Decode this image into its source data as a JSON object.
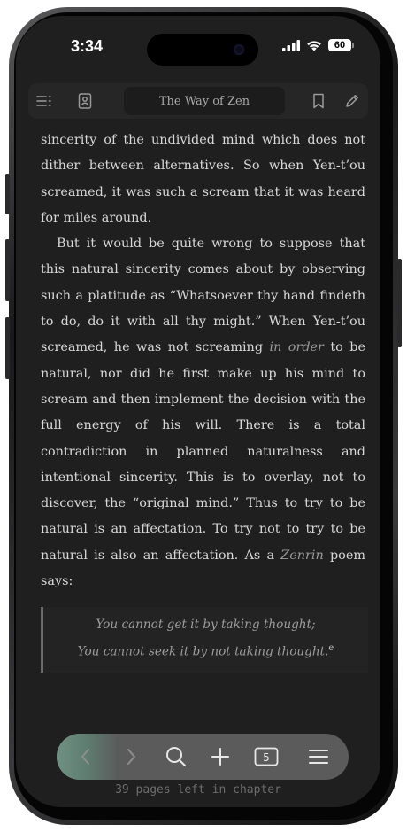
{
  "status_bar": {
    "time": "3:34",
    "battery": "60",
    "icons": [
      "cellular-signal-icon",
      "wifi-icon",
      "battery-icon"
    ]
  },
  "toolbar": {
    "title": "The Way of Zen",
    "icons": [
      "table-of-contents-icon",
      "book-info-icon",
      "bookmark-icon",
      "pencil-icon"
    ]
  },
  "content": {
    "p1": "sincerity of the undivided mind which does not dither between alternatives. So when Yen-t’ou screamed, it was such a scream that it was heard for miles around.",
    "p2_a": "But it would be quite wrong to suppose that this natural sincerity comes about by observing such a platitude as “Whatsoever thy hand findeth to do, do it with all thy might.” When Yen-t’ou screamed, he was not screaming ",
    "p2_em": "in order",
    "p2_b": " to be natural, nor did he first make up his mind to scream and then implement the decision with the full energy of his will. There is a total contradiction in planned naturalness and intentional sincerity. This is to overlay, not to discover, the “original mind.” Thus to try to be natural is an affectation. To try not to try to be natural is also an affectation. As a ",
    "p2_em2": "Zenrin",
    "p2_c": " poem says:"
  },
  "quote": {
    "line1": "You cannot get it by taking thought;",
    "line2": "You cannot seek it by not taking thought.",
    "footnote": "e"
  },
  "bottom_nav": {
    "items": [
      "back-arrow-icon",
      "forward-arrow-icon",
      "search-icon",
      "plus-icon",
      "page-counter-icon",
      "menu-icon"
    ],
    "page_badge": "5"
  },
  "footer": {
    "pages_left": "39 pages left in chapter"
  },
  "colors": {
    "background": "#1f1f1f",
    "text": "#d8d8d8",
    "accent_glow": "#6f9182"
  }
}
